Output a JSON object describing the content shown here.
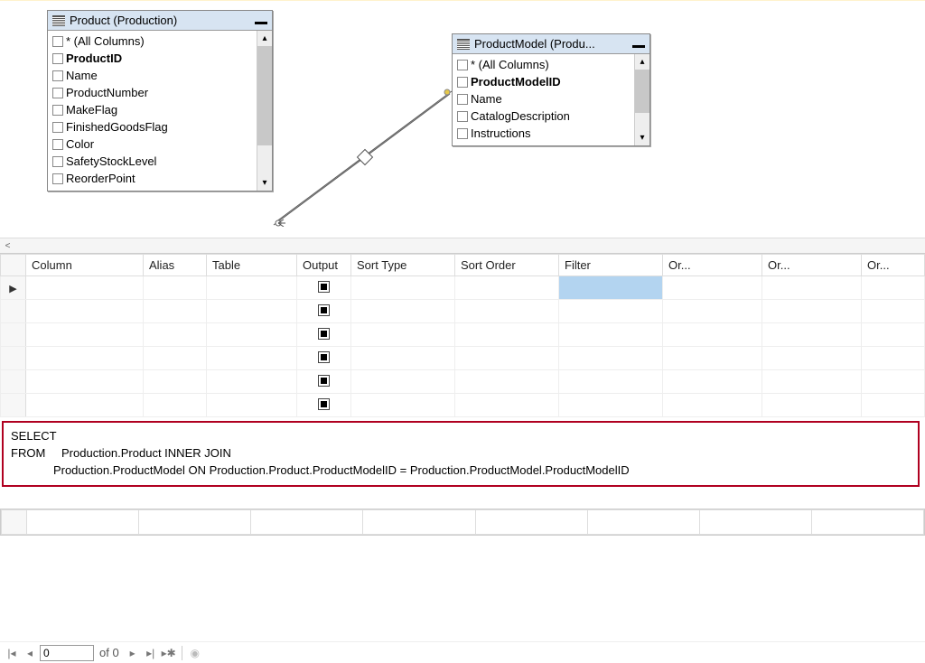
{
  "tables": {
    "product": {
      "title": "Product (Production)",
      "columns": [
        {
          "label": "* (All Columns)",
          "bold": false
        },
        {
          "label": "ProductID",
          "bold": true
        },
        {
          "label": "Name",
          "bold": false
        },
        {
          "label": "ProductNumber",
          "bold": false
        },
        {
          "label": "MakeFlag",
          "bold": false
        },
        {
          "label": "FinishedGoodsFlag",
          "bold": false
        },
        {
          "label": "Color",
          "bold": false
        },
        {
          "label": "SafetyStockLevel",
          "bold": false
        },
        {
          "label": "ReorderPoint",
          "bold": false
        }
      ]
    },
    "productmodel": {
      "title": "ProductModel (Produ...",
      "columns": [
        {
          "label": "* (All Columns)",
          "bold": false
        },
        {
          "label": "ProductModelID",
          "bold": true
        },
        {
          "label": "Name",
          "bold": false
        },
        {
          "label": "CatalogDescription",
          "bold": false
        },
        {
          "label": "Instructions",
          "bold": false
        }
      ]
    }
  },
  "grid": {
    "headers": [
      "Column",
      "Alias",
      "Table",
      "Output",
      "Sort Type",
      "Sort Order",
      "Filter",
      "Or...",
      "Or...",
      "Or..."
    ],
    "rowcount": 6,
    "filter_selected_row": 0
  },
  "sql": {
    "line1_kw": "SELECT",
    "line2_kw": "FROM",
    "line2_rest": "Production.Product INNER JOIN",
    "line3": "             Production.ProductModel ON Production.Product.ProductModelID = Production.ProductModel.ProductModelID"
  },
  "nav": {
    "value": "0",
    "of_text": "of 0"
  }
}
